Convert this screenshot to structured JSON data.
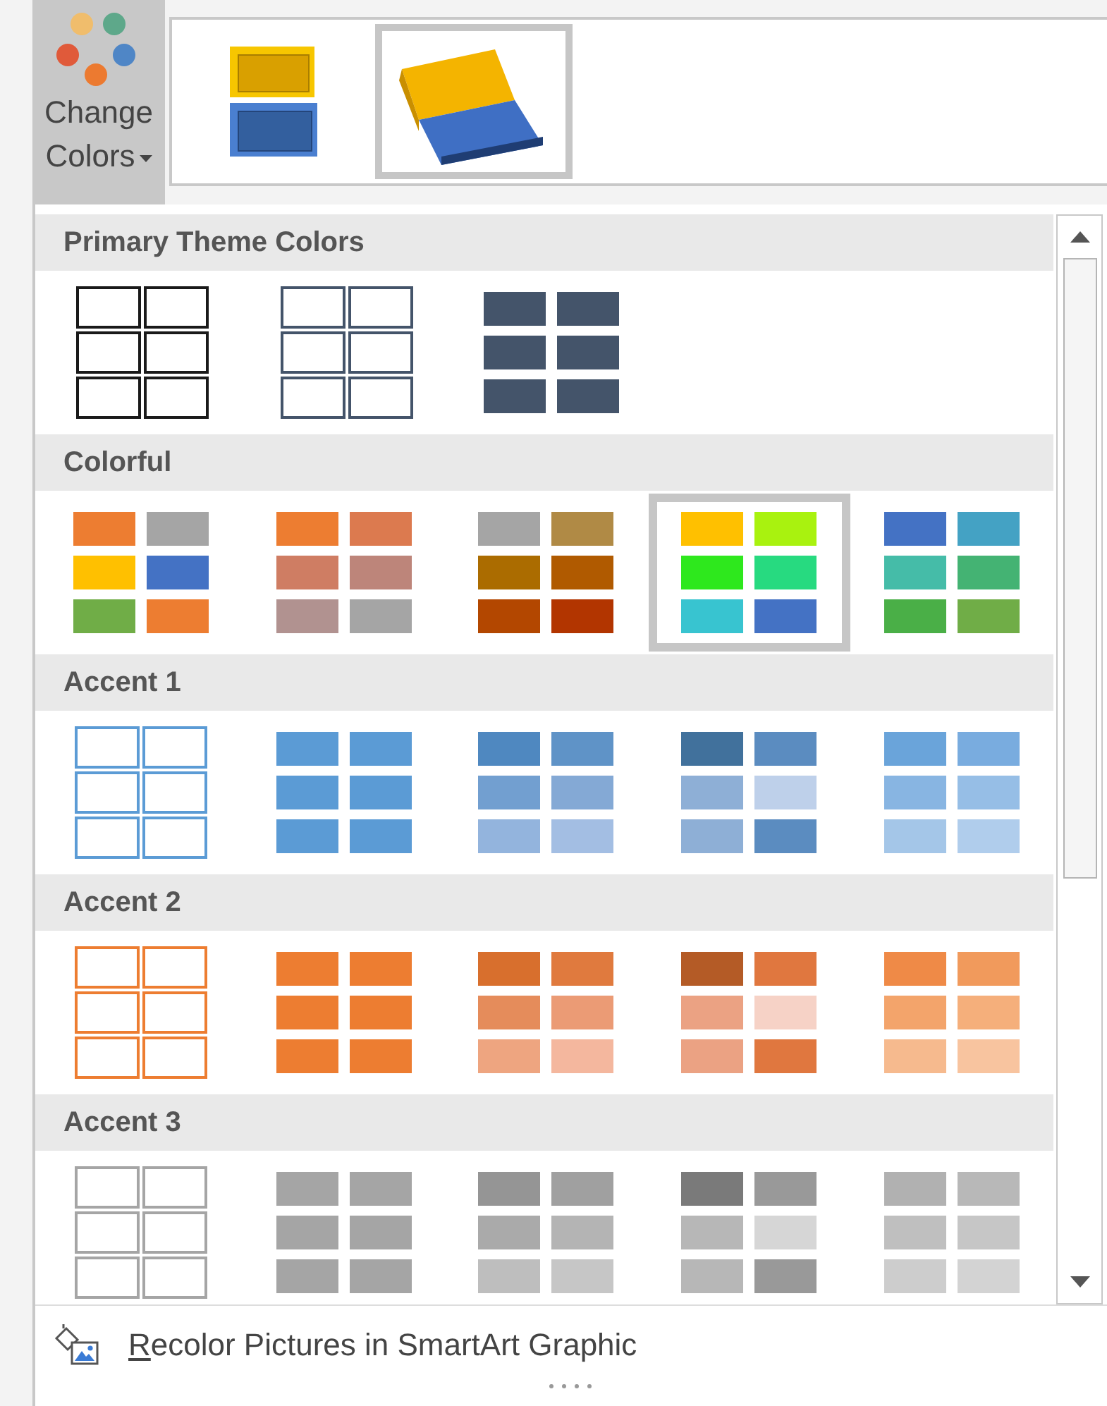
{
  "change_colors_button": {
    "label": "Change Colors"
  },
  "layout_previews": [
    {
      "kind": "flat",
      "selected": false
    },
    {
      "kind": "tilted",
      "selected": true
    }
  ],
  "sections": [
    {
      "title": "Primary Theme Colors",
      "options": [
        {
          "kind": "outline",
          "selected": false,
          "cells": [
            {
              "color": "#1a1a1a"
            },
            {
              "color": "#1a1a1a"
            },
            {
              "color": "#1a1a1a"
            },
            {
              "color": "#1a1a1a"
            },
            {
              "color": "#1a1a1a"
            },
            {
              "color": "#1a1a1a"
            }
          ]
        },
        {
          "kind": "outline",
          "selected": false,
          "cells": [
            {
              "color": "#44546a"
            },
            {
              "color": "#44546a"
            },
            {
              "color": "#44546a"
            },
            {
              "color": "#44546a"
            },
            {
              "color": "#44546a"
            },
            {
              "color": "#44546a"
            }
          ]
        },
        {
          "kind": "filled",
          "selected": false,
          "cells": [
            {
              "color": "#44546a"
            },
            {
              "color": "#44546a"
            },
            {
              "color": "#44546a"
            },
            {
              "color": "#44546a"
            },
            {
              "color": "#44546a"
            },
            {
              "color": "#44546a"
            }
          ]
        }
      ]
    },
    {
      "title": "Colorful",
      "options": [
        {
          "kind": "filled",
          "selected": false,
          "cells": [
            {
              "color": "#ed7d31"
            },
            {
              "color": "#a5a5a5"
            },
            {
              "color": "#ffc000"
            },
            {
              "color": "#4472c4"
            },
            {
              "color": "#70ad47"
            },
            {
              "color": "#ed7d31"
            }
          ]
        },
        {
          "kind": "filled",
          "selected": false,
          "cells": [
            {
              "color": "#ed7d31"
            },
            {
              "color": "#dc7a4f"
            },
            {
              "color": "#cf7d63"
            },
            {
              "color": "#bd857a"
            },
            {
              "color": "#b19290"
            },
            {
              "color": "#a5a5a5"
            }
          ]
        },
        {
          "kind": "filled",
          "selected": false,
          "cells": [
            {
              "color": "#a5a5a5"
            },
            {
              "color": "#b08a45"
            },
            {
              "color": "#ab6c00"
            },
            {
              "color": "#b05a00"
            },
            {
              "color": "#b34700"
            },
            {
              "color": "#b23500"
            }
          ]
        },
        {
          "kind": "filled",
          "selected": true,
          "cells": [
            {
              "color": "#ffc000"
            },
            {
              "color": "#a9f20f"
            },
            {
              "color": "#2ee81d"
            },
            {
              "color": "#27da80"
            },
            {
              "color": "#38c4d0"
            },
            {
              "color": "#4472c4"
            }
          ]
        },
        {
          "kind": "filled",
          "selected": false,
          "cells": [
            {
              "color": "#4472c4"
            },
            {
              "color": "#44a2c4"
            },
            {
              "color": "#45bca8"
            },
            {
              "color": "#44b373"
            },
            {
              "color": "#4aaf47"
            },
            {
              "color": "#70ad47"
            }
          ]
        }
      ]
    },
    {
      "title": "Accent 1",
      "options": [
        {
          "kind": "outline",
          "selected": false,
          "cells": [
            {
              "color": "#5b9bd5"
            },
            {
              "color": "#5b9bd5"
            },
            {
              "color": "#5b9bd5"
            },
            {
              "color": "#5b9bd5"
            },
            {
              "color": "#5b9bd5"
            },
            {
              "color": "#5b9bd5"
            }
          ]
        },
        {
          "kind": "filled",
          "selected": false,
          "cells": [
            {
              "color": "#5b9bd5"
            },
            {
              "color": "#5b9bd5"
            },
            {
              "color": "#5b9bd5"
            },
            {
              "color": "#5b9bd5"
            },
            {
              "color": "#5b9bd5"
            },
            {
              "color": "#5b9bd5"
            }
          ]
        },
        {
          "kind": "filled",
          "selected": false,
          "cells": [
            {
              "color": "#4f88c0"
            },
            {
              "color": "#5f93c7"
            },
            {
              "color": "#729fd0"
            },
            {
              "color": "#84a9d5"
            },
            {
              "color": "#93b4dd"
            },
            {
              "color": "#a3bee3"
            }
          ]
        },
        {
          "kind": "filled",
          "selected": false,
          "cells": [
            {
              "color": "#41719c"
            },
            {
              "color": "#5b8cc0"
            },
            {
              "color": "#8eafd6"
            },
            {
              "color": "#bed0ea"
            },
            {
              "color": "#8eafd6"
            },
            {
              "color": "#5b8cc0"
            }
          ]
        },
        {
          "kind": "filled",
          "selected": false,
          "cells": [
            {
              "color": "#6aa4da"
            },
            {
              "color": "#79acdf"
            },
            {
              "color": "#88b5e2"
            },
            {
              "color": "#96bee6"
            },
            {
              "color": "#a4c6e8"
            },
            {
              "color": "#b0cdec"
            }
          ]
        }
      ]
    },
    {
      "title": "Accent 2",
      "options": [
        {
          "kind": "outline",
          "selected": false,
          "cells": [
            {
              "color": "#ed7d31"
            },
            {
              "color": "#ed7d31"
            },
            {
              "color": "#ed7d31"
            },
            {
              "color": "#ed7d31"
            },
            {
              "color": "#ed7d31"
            },
            {
              "color": "#ed7d31"
            }
          ]
        },
        {
          "kind": "filled",
          "selected": false,
          "cells": [
            {
              "color": "#ed7d31"
            },
            {
              "color": "#ed7d31"
            },
            {
              "color": "#ed7d31"
            },
            {
              "color": "#ed7d31"
            },
            {
              "color": "#ed7d31"
            },
            {
              "color": "#ed7d31"
            }
          ]
        },
        {
          "kind": "filled",
          "selected": false,
          "cells": [
            {
              "color": "#d86f2d"
            },
            {
              "color": "#e07a3e"
            },
            {
              "color": "#e58c5b"
            },
            {
              "color": "#eb9b75"
            },
            {
              "color": "#eea580"
            },
            {
              "color": "#f4b79e"
            }
          ]
        },
        {
          "kind": "filled",
          "selected": false,
          "cells": [
            {
              "color": "#b45b26"
            },
            {
              "color": "#e0773f"
            },
            {
              "color": "#eba283"
            },
            {
              "color": "#f6d2c6"
            },
            {
              "color": "#eba283"
            },
            {
              "color": "#e0773f"
            }
          ]
        },
        {
          "kind": "filled",
          "selected": false,
          "cells": [
            {
              "color": "#ef8a47"
            },
            {
              "color": "#f19a5c"
            },
            {
              "color": "#f3a46b"
            },
            {
              "color": "#f5af7b"
            },
            {
              "color": "#f6ba8e"
            },
            {
              "color": "#f8c49f"
            }
          ]
        }
      ]
    },
    {
      "title": "Accent 3",
      "options": [
        {
          "kind": "outline",
          "selected": false,
          "cells": [
            {
              "color": "#a5a5a5"
            },
            {
              "color": "#a5a5a5"
            },
            {
              "color": "#a5a5a5"
            },
            {
              "color": "#a5a5a5"
            },
            {
              "color": "#a5a5a5"
            },
            {
              "color": "#a5a5a5"
            }
          ]
        },
        {
          "kind": "filled",
          "selected": false,
          "cells": [
            {
              "color": "#a5a5a5"
            },
            {
              "color": "#a5a5a5"
            },
            {
              "color": "#a5a5a5"
            },
            {
              "color": "#a5a5a5"
            },
            {
              "color": "#a5a5a5"
            },
            {
              "color": "#a5a5a5"
            }
          ]
        },
        {
          "kind": "filled",
          "selected": false,
          "cells": [
            {
              "color": "#959595"
            },
            {
              "color": "#a0a0a0"
            },
            {
              "color": "#aaaaaa"
            },
            {
              "color": "#b4b4b4"
            },
            {
              "color": "#bebebe"
            },
            {
              "color": "#c6c6c6"
            }
          ]
        },
        {
          "kind": "filled",
          "selected": false,
          "cells": [
            {
              "color": "#7a7a7a"
            },
            {
              "color": "#999999"
            },
            {
              "color": "#b7b7b7"
            },
            {
              "color": "#d6d6d6"
            },
            {
              "color": "#b7b7b7"
            },
            {
              "color": "#999999"
            }
          ]
        },
        {
          "kind": "filled",
          "selected": false,
          "cells": [
            {
              "color": "#b1b1b1"
            },
            {
              "color": "#b8b8b8"
            },
            {
              "color": "#bfbfbf"
            },
            {
              "color": "#c6c6c6"
            },
            {
              "color": "#cdcdcd"
            },
            {
              "color": "#d3d3d3"
            }
          ]
        }
      ]
    }
  ],
  "footer": {
    "label": "Recolor Pictures in SmartArt Graphic"
  }
}
